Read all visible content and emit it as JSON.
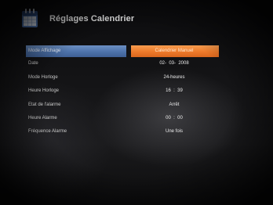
{
  "header": {
    "title": "Réglages Calendrier",
    "icon": "calendar-icon"
  },
  "settings": [
    {
      "label": "Mode Affichage",
      "value": "Calendrier Manuel",
      "selected": true
    },
    {
      "label": "Date",
      "value": "02-  03-  2008"
    },
    {
      "label": "Mode Horloge",
      "value": "24-heures"
    },
    {
      "label": "Heure Horloge",
      "value": "16  :  39"
    },
    {
      "label": "Etat de l'alarme",
      "value": "Arrêt"
    },
    {
      "label": "Heure Alarme",
      "value": "00  :  00"
    },
    {
      "label": "Fréquence Alarme",
      "value": "Une fois"
    }
  ],
  "colors": {
    "highlight_label": "#4d72aa",
    "highlight_value": "#ee7a2a",
    "text": "#ececec",
    "background": "#111113"
  }
}
